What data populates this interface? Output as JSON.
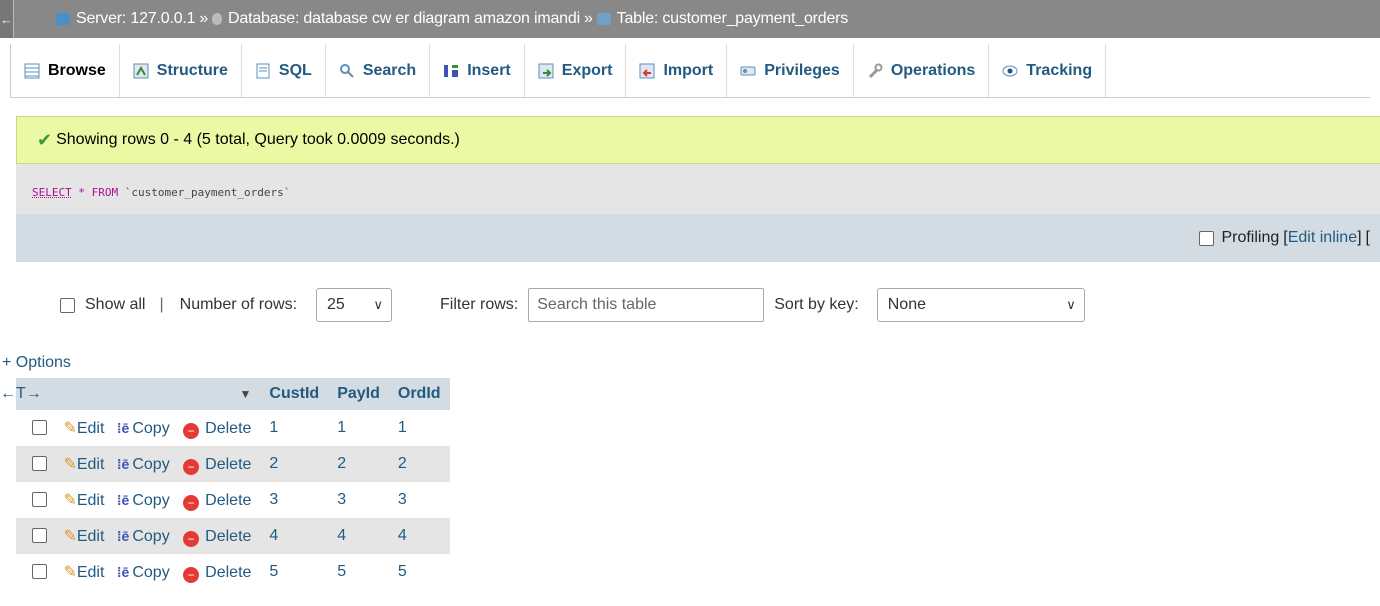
{
  "breadcrumb": {
    "back": "←",
    "server": "Server: 127.0.0.1",
    "sep1": "»",
    "database": "Database: database cw er diagram amazon imandi",
    "sep2": "»",
    "table": "Table: customer_payment_orders"
  },
  "tabs": [
    {
      "label": "Browse",
      "icon": "browse-icon"
    },
    {
      "label": "Structure",
      "icon": "structure-icon"
    },
    {
      "label": "SQL",
      "icon": "sql-icon"
    },
    {
      "label": "Search",
      "icon": "search-icon"
    },
    {
      "label": "Insert",
      "icon": "insert-icon"
    },
    {
      "label": "Export",
      "icon": "export-icon"
    },
    {
      "label": "Import",
      "icon": "import-icon"
    },
    {
      "label": "Privileges",
      "icon": "privileges-icon"
    },
    {
      "label": "Operations",
      "icon": "wrench-icon"
    },
    {
      "label": "Tracking",
      "icon": "eye-icon"
    }
  ],
  "message": "Showing rows 0 - 4 (5 total, Query took 0.0009 seconds.)",
  "sql": {
    "select": "SELECT",
    "star": "*",
    "from": "FROM",
    "table": "`customer_payment_orders`"
  },
  "profiling": {
    "label": "Profiling",
    "edit_inline": "Edit inline",
    "bracket_open": "[",
    "bracket_close": "]",
    "trailing": "["
  },
  "nav": {
    "show_all": "Show all",
    "divider": "|",
    "rows_label": "Number of rows:",
    "rows_value": "25",
    "filter_label": "Filter rows:",
    "filter_placeholder": "Search this table",
    "sort_label": "Sort by key:",
    "sort_value": "None"
  },
  "options_link": "+ Options",
  "table": {
    "resize_glyph": "←T→",
    "sort_arrow": "▼",
    "columns": [
      "CustId",
      "PayId",
      "OrdId"
    ],
    "actions": {
      "edit": "Edit",
      "copy": "Copy",
      "delete": "Delete"
    },
    "rows": [
      [
        "1",
        "1",
        "1"
      ],
      [
        "2",
        "2",
        "2"
      ],
      [
        "3",
        "3",
        "3"
      ],
      [
        "4",
        "4",
        "4"
      ],
      [
        "5",
        "5",
        "5"
      ]
    ]
  },
  "colors": {
    "accent": "#235a81",
    "success_bg": "#ebf8a4",
    "header_bg": "#d3dce3",
    "breadcrumb_bg": "#888888"
  }
}
